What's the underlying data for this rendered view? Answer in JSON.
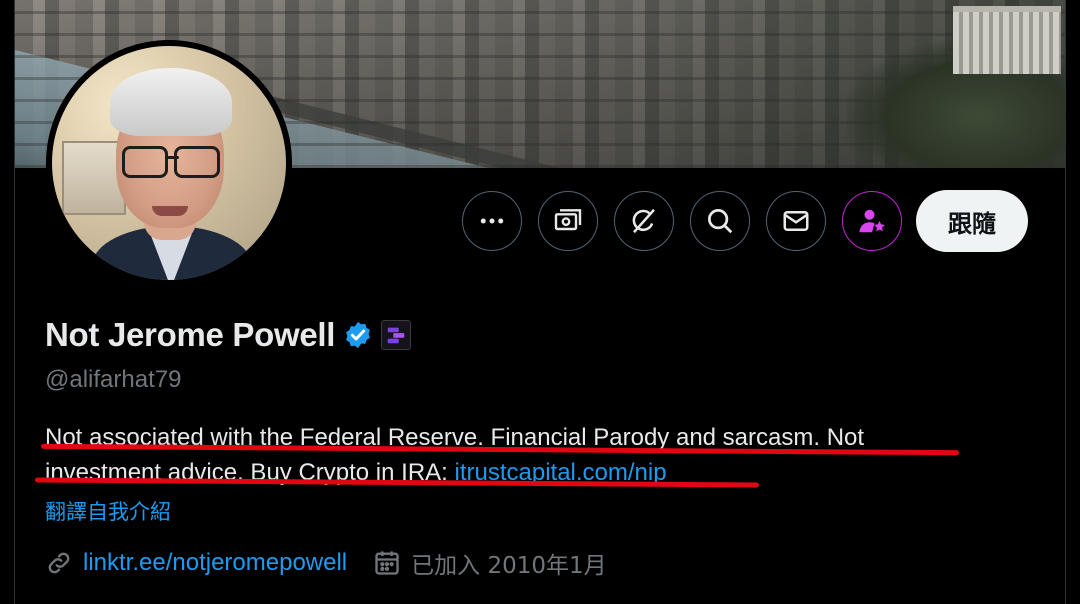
{
  "profile": {
    "name": "Not Jerome Powell",
    "handle": "@alifarhat79",
    "bio_line1": "Not associated with the Federal Reserve. Financial Parody and sarcasm. Not",
    "bio_line2_text": "investment advice. Buy Crypto in IRA: ",
    "bio_link": "itrustcapital.com/nip",
    "translate_label": "翻譯自我介紹",
    "website": "linktr.ee/notjeromepowell",
    "joined": "已加入 2010年1月"
  },
  "actions": {
    "more_icon": "more-dots-icon",
    "subscribe_icon": "money-icon",
    "grok_icon": "grok-icon",
    "search_icon": "search-icon",
    "message_icon": "mail-icon",
    "subscriber_icon": "person-star-icon",
    "follow_label": "跟隨"
  },
  "colors": {
    "background": "#000000",
    "link": "#1d9bf0",
    "muted": "#71767b",
    "verified": "#1d9bf0",
    "annotation_underline": "#e10612",
    "subscriber_accent": "#c026d3"
  }
}
